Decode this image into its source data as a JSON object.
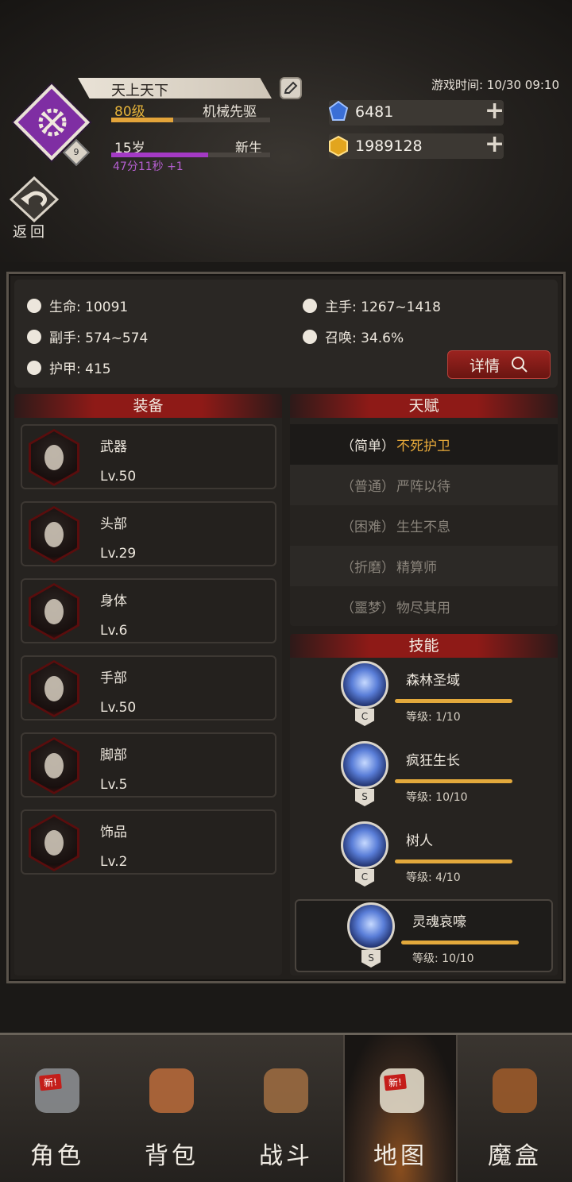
{
  "header": {
    "player_name": "天上天下",
    "level": "80级",
    "class_name": "机械先驱",
    "class_badge_number": "9",
    "age": "15岁",
    "age_stage": "新生",
    "age_timer": "47分11秒 +1",
    "game_time_label": "游戏时间: 10/30 09:10",
    "level_progress": 0.39,
    "age_progress": 0.61
  },
  "currency": {
    "gems": "6481",
    "gold": "1989128",
    "gem_color": "#3b6fd6",
    "gold_color": "#e2a51e"
  },
  "back_label": "返回",
  "stats": {
    "hp": "生命: 10091",
    "main_hand": "主手: 1267~1418",
    "off_hand": "副手: 574~574",
    "summon": "召唤: 34.6%",
    "armor": "护甲: 415",
    "details_label": "详情"
  },
  "equipment": {
    "title": "装备",
    "items": [
      {
        "slot": "武器",
        "level": "Lv.50",
        "icon": "staff-icon"
      },
      {
        "slot": "头部",
        "level": "Lv.29",
        "icon": "wizard-hat-icon"
      },
      {
        "slot": "身体",
        "level": "Lv.6",
        "icon": "armor-icon"
      },
      {
        "slot": "手部",
        "level": "Lv.50",
        "icon": "gauntlet-icon"
      },
      {
        "slot": "脚部",
        "level": "Lv.5",
        "icon": "boots-icon"
      },
      {
        "slot": "饰品",
        "level": "Lv.2",
        "icon": "trinket-icon"
      }
    ]
  },
  "talents": {
    "title": "天赋",
    "items": [
      {
        "difficulty": "（简单）",
        "name": "不死护卫"
      },
      {
        "difficulty": "（普通）",
        "name": "严阵以待"
      },
      {
        "difficulty": "（困难）",
        "name": "生生不息"
      },
      {
        "difficulty": "（折磨）",
        "name": "精算师"
      },
      {
        "difficulty": "（噩梦）",
        "name": "物尽其用"
      }
    ]
  },
  "skills": {
    "title": "技能",
    "items": [
      {
        "name": "森林圣域",
        "level": "等级: 1/10",
        "grade": "C"
      },
      {
        "name": "疯狂生长",
        "level": "等级: 10/10",
        "grade": "S"
      },
      {
        "name": "树人",
        "level": "等级: 4/10",
        "grade": "C"
      },
      {
        "name": "灵魂哀嚎",
        "level": "等级: 10/10",
        "grade": "S"
      }
    ]
  },
  "nav": {
    "items": [
      {
        "label": "角色",
        "badge": "新!"
      },
      {
        "label": "背包",
        "badge": ""
      },
      {
        "label": "战斗",
        "badge": ""
      },
      {
        "label": "地图",
        "badge": "新!"
      },
      {
        "label": "魔盒",
        "badge": ""
      }
    ],
    "active": "地图"
  }
}
